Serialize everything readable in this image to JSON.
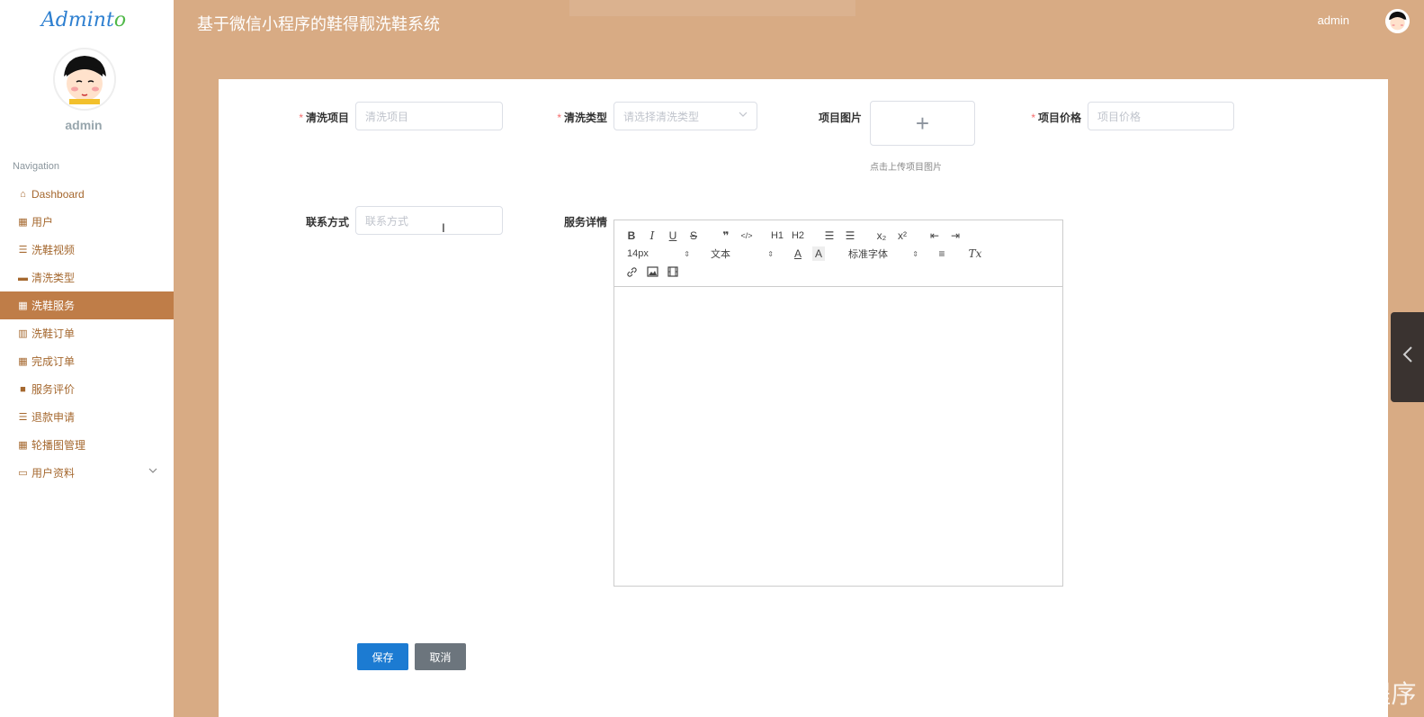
{
  "sidebar": {
    "logo_main": "Admint",
    "logo_o": "o",
    "user": "admin",
    "nav_title": "Navigation",
    "items": [
      {
        "label": "Dashboard",
        "icon": "home-icon"
      },
      {
        "label": "用户",
        "icon": "grid-icon"
      },
      {
        "label": "洗鞋视频",
        "icon": "list-icon"
      },
      {
        "label": "清洗类型",
        "icon": "monitor-icon"
      },
      {
        "label": "洗鞋服务",
        "icon": "grid-icon",
        "active": true
      },
      {
        "label": "洗鞋订单",
        "icon": "library-icon"
      },
      {
        "label": "完成订单",
        "icon": "grid-icon"
      },
      {
        "label": "服务评价",
        "icon": "video-icon"
      },
      {
        "label": "退款申请",
        "icon": "list-icon"
      },
      {
        "label": "轮播图管理",
        "icon": "apps-icon"
      },
      {
        "label": "用户资料",
        "icon": "card-icon",
        "has_children": true
      }
    ]
  },
  "header": {
    "title": "基于微信小程序的鞋得靓洗鞋系统",
    "user": "admin"
  },
  "form": {
    "project": {
      "label": "清洗项目",
      "placeholder": "清洗项目",
      "required": true
    },
    "type": {
      "label": "清洗类型",
      "placeholder": "请选择清洗类型",
      "required": true
    },
    "image": {
      "label": "项目图片",
      "tip": "点击上传项目图片",
      "plus": "+"
    },
    "price": {
      "label": "项目价格",
      "placeholder": "项目价格",
      "required": true
    },
    "contact": {
      "label": "联系方式",
      "placeholder": "联系方式"
    },
    "detail": {
      "label": "服务详情"
    }
  },
  "editor": {
    "bold": "B",
    "italic": "I",
    "underline": "U",
    "strike": "S",
    "quote": "❞",
    "code": "</>",
    "h1": "H1",
    "h2": "H2",
    "ol": "☰",
    "ul": "☰",
    "sub": "x₂",
    "sup": "x²",
    "outdent": "⇤",
    "indent": "⇥",
    "size": "14px",
    "block": "文本",
    "font": "标准字体",
    "color": "A",
    "bg": "A",
    "align": "≡",
    "clean": "Tx"
  },
  "buttons": {
    "save": "保存",
    "cancel": "取消"
  },
  "watermark": "CSDN @梁凯毕设程序",
  "colors": {
    "accent": "#bf7d48",
    "header_bg": "#d8ab84",
    "primary": "#1c7bd2"
  }
}
